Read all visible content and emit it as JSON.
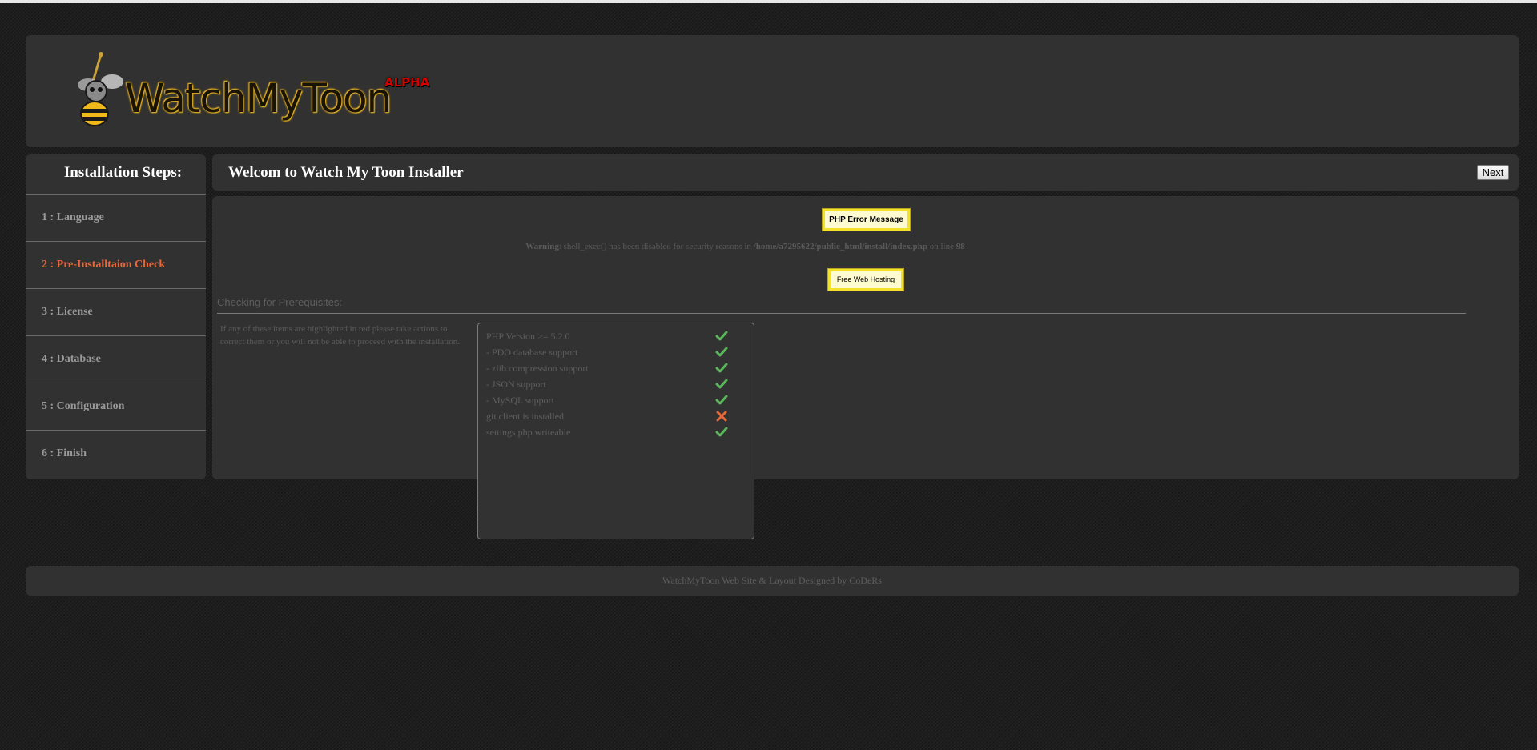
{
  "header": {
    "logo_text": "WatchMyToon",
    "logo_badge": "ALPHA"
  },
  "sidebar": {
    "title": "Installation Steps:",
    "steps": [
      {
        "label": "1 : Language",
        "active": false
      },
      {
        "label": "2 : Pre-Installtaion Check",
        "active": true
      },
      {
        "label": "3 : License",
        "active": false
      },
      {
        "label": "4 : Database",
        "active": false
      },
      {
        "label": "5 : Configuration",
        "active": false
      },
      {
        "label": "6 : Finish",
        "active": false
      }
    ]
  },
  "titlebar": {
    "title": "Welcom to Watch My Toon Installer",
    "next_label": "Next"
  },
  "content": {
    "php_error_label": "PHP Error Message",
    "warning": {
      "prefix": "Warning",
      "message": ": shell_exec() has been disabled for security reasons in ",
      "path": "/home/a7295622/public_html/install/index.php",
      "line_text": " on line ",
      "line_number": "98"
    },
    "free_hosting_label": "Free Web Hosting",
    "section_title": "Checking for Prerequisites:",
    "instructions": "If any of these items are highlighted in red please take actions to correct them or you will not be able to proceed with the installation.",
    "checks": [
      {
        "label": "PHP Version >= 5.2.0",
        "passed": true
      },
      {
        "label": "- PDO database support",
        "passed": true
      },
      {
        "label": "- zlib compression support",
        "passed": true
      },
      {
        "label": "- JSON support",
        "passed": true
      },
      {
        "label": "- MySQL support",
        "passed": true
      },
      {
        "label": "git client is installed",
        "passed": false
      },
      {
        "label": "settings.php writeable",
        "passed": true
      }
    ]
  },
  "footer": {
    "text": "WatchMyToon Web Site & Layout Designed by CoDeRs"
  },
  "colors": {
    "active_step": "#e8683a",
    "check_pass": "#5cb85c",
    "check_fail": "#e8683a",
    "panel_bg": "#313131",
    "alpha_red": "#d40000"
  }
}
